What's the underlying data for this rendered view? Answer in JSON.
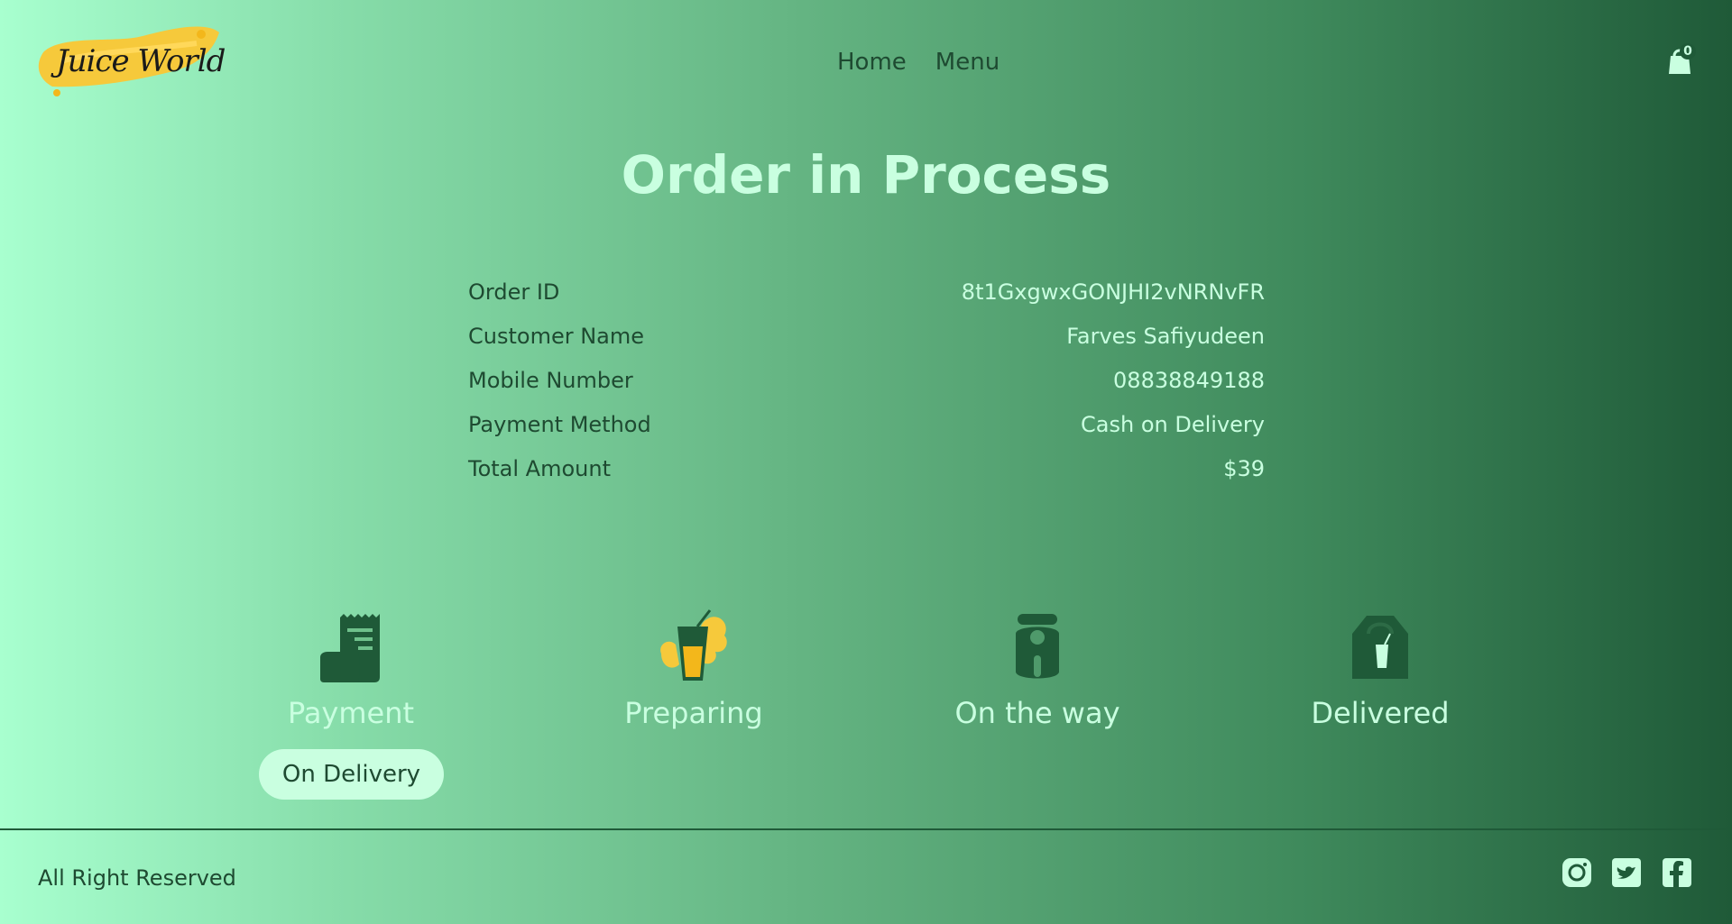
{
  "header": {
    "logo_text": "Juice World",
    "nav": [
      "Home",
      "Menu"
    ],
    "cart_count": "0"
  },
  "title": "Order in Process",
  "order": [
    {
      "label": "Order ID",
      "value": "8t1GxgwxGONJHI2vNRNvFR"
    },
    {
      "label": "Customer Name",
      "value": "Farves Safiyudeen"
    },
    {
      "label": "Mobile Number",
      "value": "08838849188"
    },
    {
      "label": "Payment Method",
      "value": "Cash on Delivery"
    },
    {
      "label": "Total Amount",
      "value": "$39"
    }
  ],
  "steps": [
    {
      "label": "Payment",
      "icon": "receipt-icon"
    },
    {
      "label": "Preparing",
      "icon": "juice-glass-icon"
    },
    {
      "label": "On the way",
      "icon": "scooter-icon"
    },
    {
      "label": "Delivered",
      "icon": "takeaway-bag-icon"
    }
  ],
  "status_badge": "On Delivery",
  "footer": {
    "text": "All Right Reserved",
    "social": [
      "instagram-icon",
      "twitter-icon",
      "facebook-icon"
    ]
  },
  "colors": {
    "accent": "#c9ffe0",
    "dark": "#1f5a38",
    "text": "#1e4a31"
  }
}
